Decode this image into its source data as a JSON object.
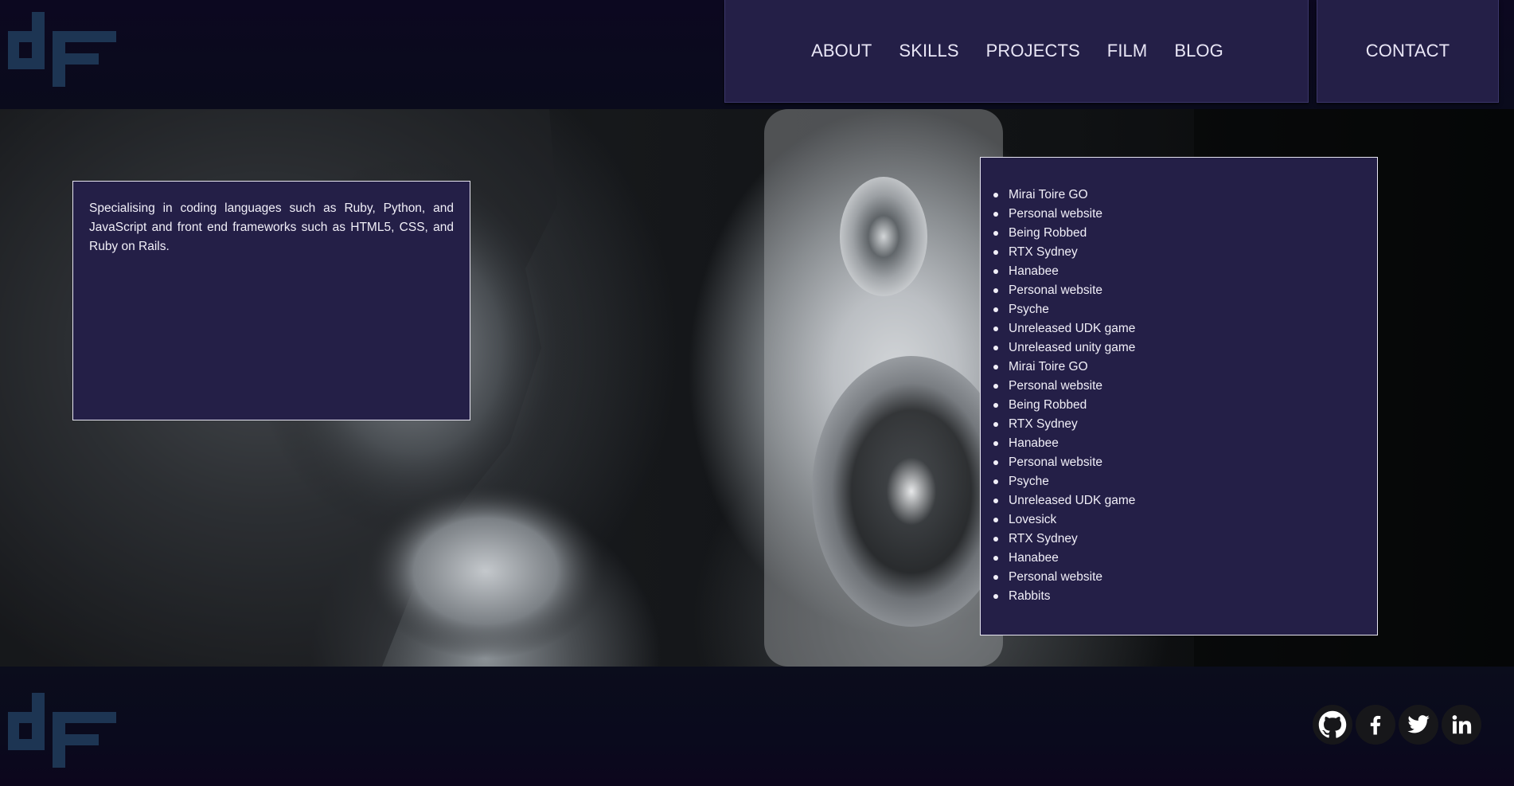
{
  "header": {
    "logo_text": "dF",
    "nav": [
      "ABOUT",
      "SKILLS",
      "PROJECTS",
      "FILM",
      "BLOG"
    ],
    "contact_label": "CONTACT"
  },
  "about": {
    "text": "Specialising in coding languages such as Ruby, Python, and JavaScript and front end frameworks such as HTML5, CSS, and Ruby on Rails."
  },
  "projects": [
    "Mirai Toire GO",
    "Personal website",
    "Being Robbed",
    "RTX Sydney",
    "Hanabee",
    "Personal website",
    "Psyche",
    "Unreleased UDK game",
    "Unreleased unity game",
    "Mirai Toire GO",
    "Personal website",
    "Being Robbed",
    "RTX Sydney",
    "Hanabee",
    "Personal website",
    "Psyche",
    "Unreleased UDK game",
    "Lovesick",
    "RTX Sydney",
    "Hanabee",
    "Personal website",
    "Rabbits"
  ],
  "footer": {
    "logo_text": "dF",
    "socials": [
      "github-icon",
      "facebook-icon",
      "twitter-icon",
      "linkedin-icon"
    ]
  },
  "colors": {
    "panel": "#241f47",
    "logo": "#1d3553",
    "background": "#0b0a1c"
  }
}
